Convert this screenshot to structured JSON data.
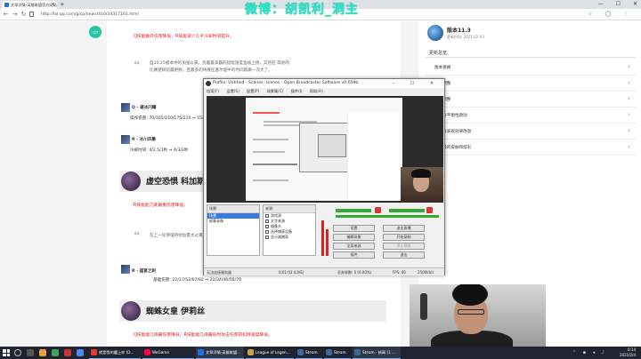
{
  "browser": {
    "tab_title": "文章详情-英雄联盟官方网站",
    "url": "http://lol.qq.com/gicp/news/410/34317161.html",
    "win_min": "—",
    "win_max": "☐",
    "win_close": "✕"
  },
  "overlay": {
    "stream_title": "微博：胡凯利_洞主"
  },
  "article": {
    "red_top": "Q技能额外伤害降低，R技能减少几乎冷却时间提升。",
    "quote_text": "自10.25版本中的加强以来，亮着最高霸的猎能速度直线上扬，又因在 其他的比赛使目前最更频，且最多的将要在塞尔提中的时间再做一次大了。",
    "skill1_name": "Q - 凝冰闪耀",
    "skill1_detail": "操作伤害: 70/105/140/175/210 ⇒ 55/90/125/160/195",
    "skill2_name": "R - 冰川风暴",
    "skill2_detail": "冷却时间: 4/2.5/1秒 ⇒ 4/3/2秒",
    "champ1": "虚空恐惧 科加斯",
    "red_mid": "R技能能几底最重伤害降低。",
    "quote2": "在上一轮增强将他加量太过重，所以他的回弹。",
    "skill3_name": "R - 盛宴之刺",
    "skill3_detail": "基础伤害: 22/37/52/67/82 ⇒ 22/34/46/58/70",
    "champ2": "蜘蛛女皇 伊莉丝",
    "red_bottom": "Q技能能几底最伤害降低，R技能能几底最低时攻击伤害的扣除速度降低。"
  },
  "sidebar": {
    "version_title": "版本11.3",
    "version_date": "更新时间: 2021-02-03",
    "toc_title": "更新总览",
    "toc": [
      "版本要闻",
      "英雄调整",
      "道具调整",
      "大乱斗平衡性改动",
      "时装及表观效果改动",
      "世界级的皮肤和炫彩"
    ]
  },
  "obs": {
    "title": "Profile: Untitled - Scenes: scenes - Open Broadcaster Software v0.659b",
    "menu": [
      "档案(F)",
      "设置(S)",
      "配置(P)",
      "场景集(C)",
      "插件(I)",
      "帮助(H)"
    ],
    "scenes_header": "场景:",
    "scenes": [
      "场景",
      "屏幕录像"
    ],
    "sources_header": "来源:",
    "sources": [
      "游戏源",
      "文字来源",
      "摄像头",
      "选择捕获设备",
      "显示器捕获"
    ],
    "buttons": [
      "设置",
      "退出直播",
      "编辑场景",
      "开始录制",
      "全局来源",
      "停止预览",
      "插件",
      "退出"
    ],
    "status_left": "无法连接服务器",
    "status_time": "0:01:03 (LIVE)",
    "status_frames": "丢弃帧数: 0 (0.00%)",
    "status_fps": "FPS: 60",
    "status_kbps": "2500kb/s"
  },
  "taskbar": {
    "apps": [
      "就是我的魔上你 (D...",
      "WeGame",
      "文章详情-英雄联盟...",
      "League of Legen...",
      "Steam",
      "Steam",
      "Steam - 新闻 (1 ..."
    ],
    "time": "0:14",
    "date": "2021/2/4"
  }
}
